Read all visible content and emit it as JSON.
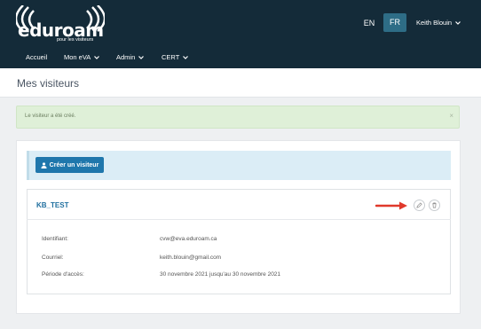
{
  "header": {
    "logo_text": "eduroam",
    "logo_tagline": "pour les visiteurs",
    "lang_en": "EN",
    "lang_fr": "FR",
    "user_name": "Keith Blouin"
  },
  "nav": {
    "items": [
      {
        "label": "Accueil"
      },
      {
        "label": "Mon eVA"
      },
      {
        "label": "Admin"
      },
      {
        "label": "CERT"
      }
    ]
  },
  "page": {
    "title": "Mes visiteurs"
  },
  "alert": {
    "message": "Le visiteur a été créé.",
    "close": "×"
  },
  "toolbar": {
    "create_label": "Créer un visiteur"
  },
  "visitor": {
    "name": "KB_TEST",
    "fields": [
      {
        "label": "Identifiant:",
        "value": "cvw@eva.eduroam.ca"
      },
      {
        "label": "Courriel:",
        "value": "keith.blouin@gmail.com"
      },
      {
        "label": "Période d'accès:",
        "value": "30 novembre 2021 jusqu'au 30 novembre 2021"
      }
    ]
  },
  "colors": {
    "header_bg": "#142b39",
    "lang_active": "#2e6d86",
    "alert_bg": "#dff0d8",
    "primary_button": "#1f77ac",
    "info_bar": "#dbedf6",
    "annotation_arrow": "#e0392b"
  }
}
